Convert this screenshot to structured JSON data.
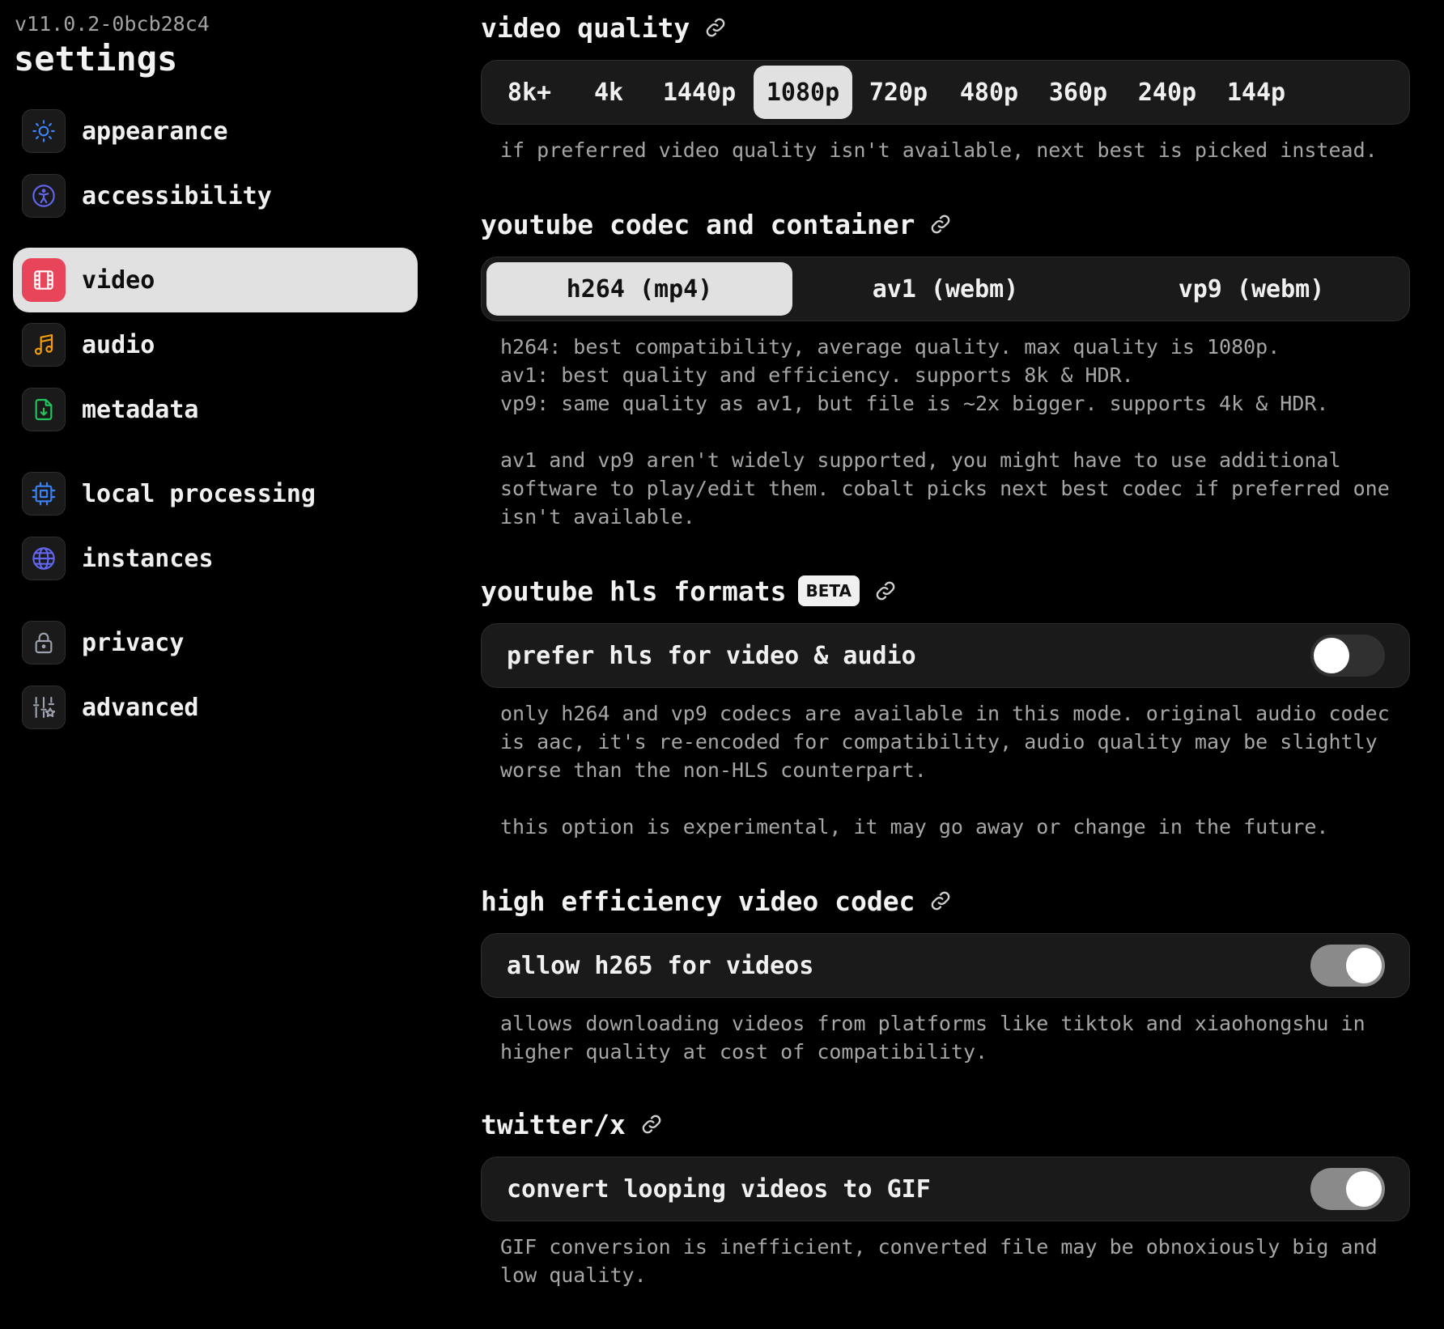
{
  "sidebar": {
    "version": "v11.0.2-0bcb28c4",
    "title": "settings",
    "groups": [
      [
        {
          "label": "appearance",
          "icon": "sun-icon",
          "color": "#3b82f6"
        },
        {
          "label": "accessibility",
          "icon": "accessibility-icon",
          "color": "#6366f1"
        }
      ],
      [
        {
          "label": "video",
          "icon": "film-icon",
          "color": "#e8445a",
          "active": true
        },
        {
          "label": "audio",
          "icon": "music-note-icon",
          "color": "#f59e0b"
        },
        {
          "label": "metadata",
          "icon": "file-download-icon",
          "color": "#22c55e"
        }
      ],
      [
        {
          "label": "local processing",
          "icon": "cpu-icon",
          "color": "#3b82f6"
        },
        {
          "label": "instances",
          "icon": "globe-icon",
          "color": "#6366f1"
        }
      ],
      [
        {
          "label": "privacy",
          "icon": "lock-icon",
          "color": "#9ca3af"
        },
        {
          "label": "advanced",
          "icon": "sliders-star-icon",
          "color": "#9ca3af"
        }
      ]
    ]
  },
  "main": {
    "video_quality": {
      "title": "video quality",
      "options": [
        "8k+",
        "4k",
        "1440p",
        "1080p",
        "720p",
        "480p",
        "360p",
        "240p",
        "144p"
      ],
      "selected": "1080p",
      "description": "if preferred video quality isn't available, next best is picked instead."
    },
    "codec": {
      "title": "youtube codec and container",
      "options": [
        "h264 (mp4)",
        "av1 (webm)",
        "vp9 (webm)"
      ],
      "selected": "h264 (mp4)",
      "description": "h264: best compatibility, average quality. max quality is 1080p.\nav1: best quality and efficiency. supports 8k & HDR.\nvp9: same quality as av1, but file is ~2x bigger. supports 4k & HDR.\n\nav1 and vp9 aren't widely supported, you might have to use additional\nsoftware to play/edit them. cobalt picks next best codec if preferred one\nisn't available."
    },
    "hls": {
      "title": "youtube hls formats",
      "badge": "BETA",
      "toggle_label": "prefer hls for video & audio",
      "enabled": false,
      "description": "only h264 and vp9 codecs are available in this mode. original audio codec\nis aac, it's re-encoded for compatibility, audio quality may be slightly\nworse than the non-HLS counterpart.\n\nthis option is experimental, it may go away or change in the future."
    },
    "hevc": {
      "title": "high efficiency video codec",
      "toggle_label": "allow h265 for videos",
      "enabled": true,
      "description": "allows downloading videos from platforms like tiktok and xiaohongshu in\nhigher quality at cost of compatibility."
    },
    "twitter": {
      "title": "twitter/x",
      "toggle_label": "convert looping videos to GIF",
      "enabled": true,
      "description": "GIF conversion is inefficient, converted file may be obnoxiously big and\nlow quality."
    }
  }
}
